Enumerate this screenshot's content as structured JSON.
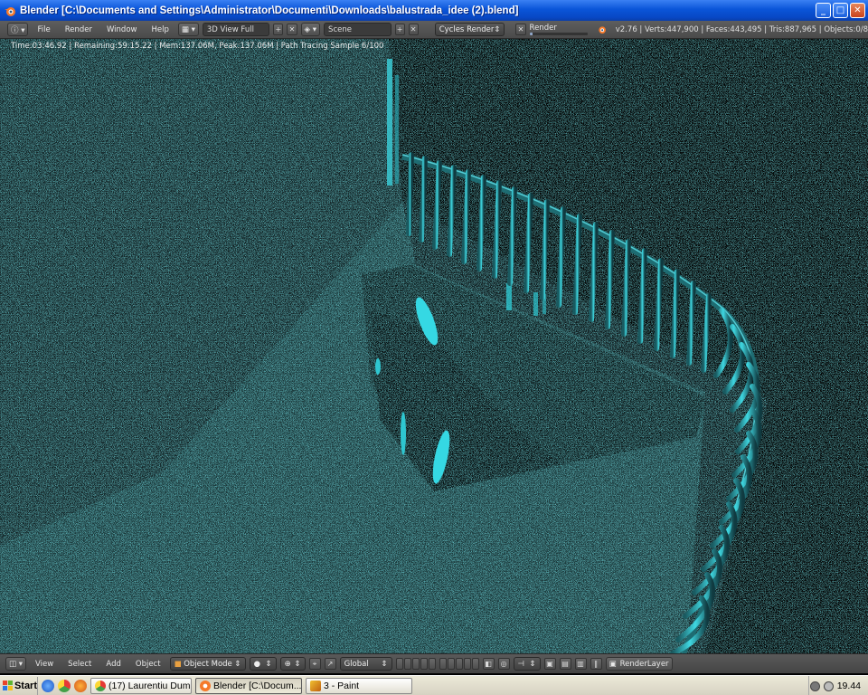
{
  "window": {
    "title": "Blender [C:\\Documents and Settings\\Administrator\\Documenti\\Downloads\\balustrada_idee (2).blend]",
    "minimize": "_",
    "maximize": "□",
    "close": "✕"
  },
  "info_header": {
    "menus": [
      "File",
      "Render",
      "Window",
      "Help"
    ],
    "screen_layout": "3D View Full",
    "scene": "Scene",
    "render_engine": "Cycles Render",
    "progress_label": "Render",
    "stats": "v2.76 | Verts:447,900 | Faces:443,495 | Tris:887,965 | Objects:0/8"
  },
  "viewport": {
    "render_status": "Time:03:46.92 | Remaining:59:15.22 | Mem:137.06M, Peak:137.06M | Path Tracing Sample 6/100"
  },
  "view_header": {
    "menus": [
      "View",
      "Select",
      "Add",
      "Object"
    ],
    "mode": "Object Mode",
    "orientation": "Global",
    "render_layer": "RenderLayer"
  },
  "taskbar": {
    "start_label": "Start",
    "tasks": [
      "(17) Laurentiu Dum...",
      "Blender [C:\\Docum...",
      "3 - Paint"
    ],
    "clock": "19.44"
  },
  "colors": {
    "accent_cyan": "#2fd6e0",
    "floor": "#1c3a3c",
    "wall": "#1a2a2c"
  }
}
